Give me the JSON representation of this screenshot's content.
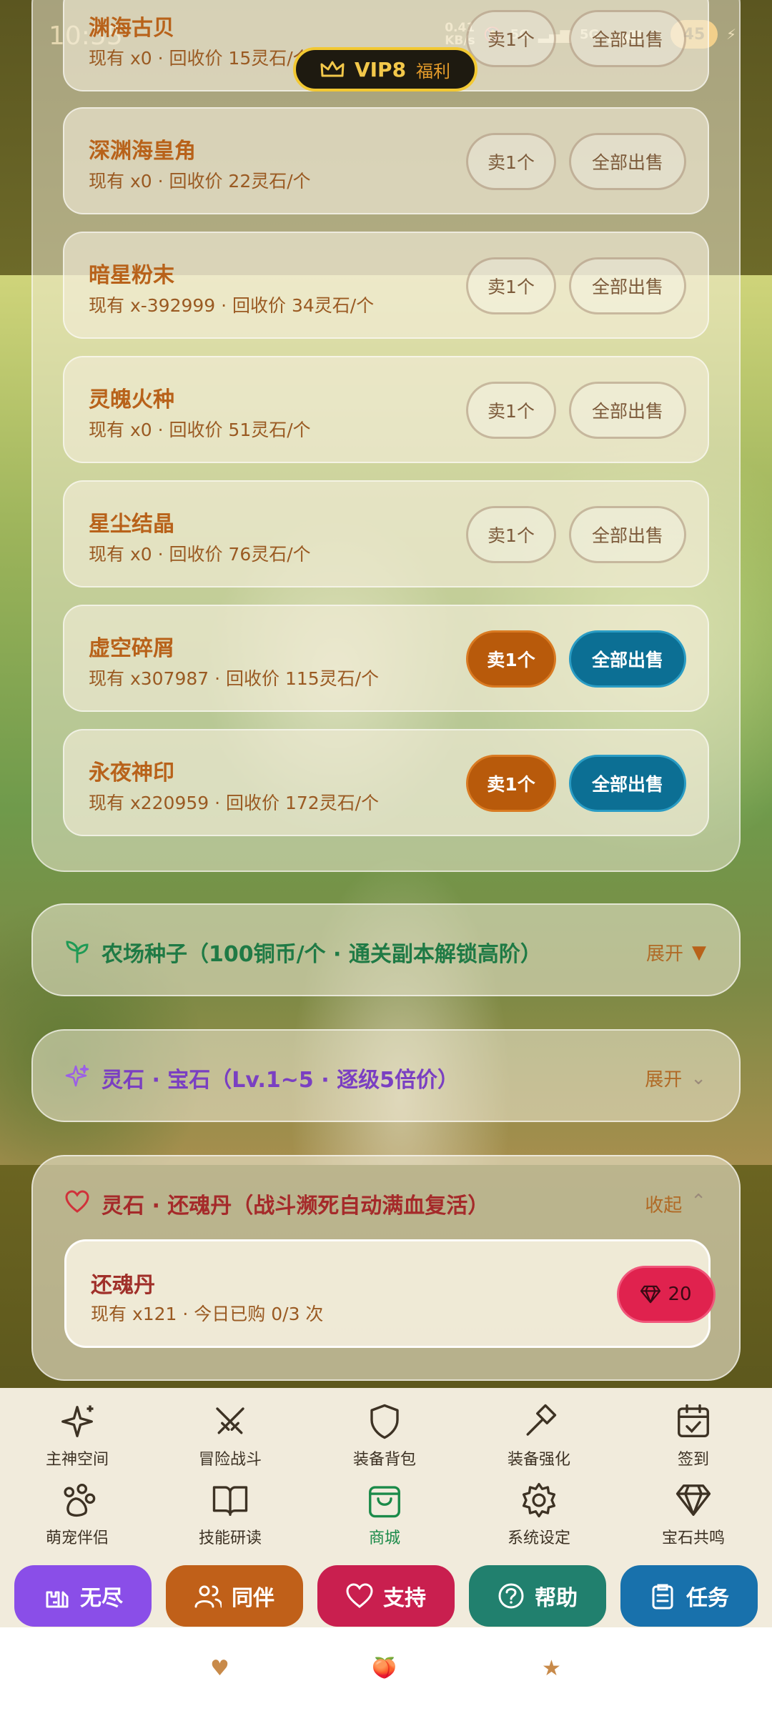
{
  "status": {
    "time": "10:55",
    "speed": "0.41\nKB/s",
    "net1": "5G",
    "net2": "5G",
    "battery": "45"
  },
  "vip": {
    "level": "VIP8",
    "perk": "福利"
  },
  "materials": [
    {
      "name": "渊海古贝",
      "meta": "现有 x0 · 回收价 15灵石/个",
      "sell_one": "卖1个",
      "sell_all": "全部出售",
      "active": false
    },
    {
      "name": "深渊海皇角",
      "meta": "现有 x0 · 回收价 22灵石/个",
      "sell_one": "卖1个",
      "sell_all": "全部出售",
      "active": false
    },
    {
      "name": "暗星粉末",
      "meta": "现有 x-392999 · 回收价 34灵石/个",
      "sell_one": "卖1个",
      "sell_all": "全部出售",
      "active": false
    },
    {
      "name": "灵魄火种",
      "meta": "现有 x0 · 回收价 51灵石/个",
      "sell_one": "卖1个",
      "sell_all": "全部出售",
      "active": false
    },
    {
      "name": "星尘结晶",
      "meta": "现有 x0 · 回收价 76灵石/个",
      "sell_one": "卖1个",
      "sell_all": "全部出售",
      "active": false
    },
    {
      "name": "虚空碎屑",
      "meta": "现有 x307987 · 回收价 115灵石/个",
      "sell_one": "卖1个",
      "sell_all": "全部出售",
      "active": true
    },
    {
      "name": "永夜神印",
      "meta": "现有 x220959 · 回收价 172灵石/个",
      "sell_one": "卖1个",
      "sell_all": "全部出售",
      "active": true
    }
  ],
  "sections": {
    "seeds": {
      "title": "农场种子（100铜币/个 · 通关副本解锁高阶）",
      "toggle": "展开",
      "color": "#1f7a45"
    },
    "gems": {
      "title": "灵石 · 宝石（Lv.1~5 · 逐级5倍价）",
      "toggle": "展开",
      "color": "#7a3fc2"
    },
    "revive": {
      "title": "灵石 · 还魂丹（战斗濒死自动满血复活）",
      "toggle": "收起",
      "color": "#a52a2a",
      "item": {
        "name": "还魂丹",
        "meta": "现有 x121 · 今日已购 0/3 次",
        "price": "20"
      }
    }
  },
  "nav": [
    {
      "label": "主神空间",
      "icon": "sparkle-icon"
    },
    {
      "label": "冒险战斗",
      "icon": "swords-icon"
    },
    {
      "label": "装备背包",
      "icon": "shield-icon"
    },
    {
      "label": "装备强化",
      "icon": "hammer-icon"
    },
    {
      "label": "签到",
      "icon": "calendar-check-icon"
    },
    {
      "label": "萌宠伴侣",
      "icon": "paw-icon"
    },
    {
      "label": "技能研读",
      "icon": "book-icon"
    },
    {
      "label": "商城",
      "icon": "shopping-bag-icon"
    },
    {
      "label": "系统设定",
      "icon": "gear-icon"
    },
    {
      "label": "宝石共鸣",
      "icon": "gem-icon"
    }
  ],
  "quick": [
    {
      "label": "无尽",
      "color": "#8a4ee8",
      "icon": "tower-icon"
    },
    {
      "label": "同伴",
      "color": "#c06019",
      "icon": "users-icon"
    },
    {
      "label": "支持",
      "color": "#c91f4f",
      "icon": "heart-icon"
    },
    {
      "label": "帮助",
      "color": "#21806e",
      "icon": "help-circle-icon"
    },
    {
      "label": "任务",
      "color": "#1871ac",
      "icon": "clipboard-icon"
    }
  ],
  "sysbar": {
    "heart": "♥",
    "apple": "🍑",
    "star": "★"
  }
}
